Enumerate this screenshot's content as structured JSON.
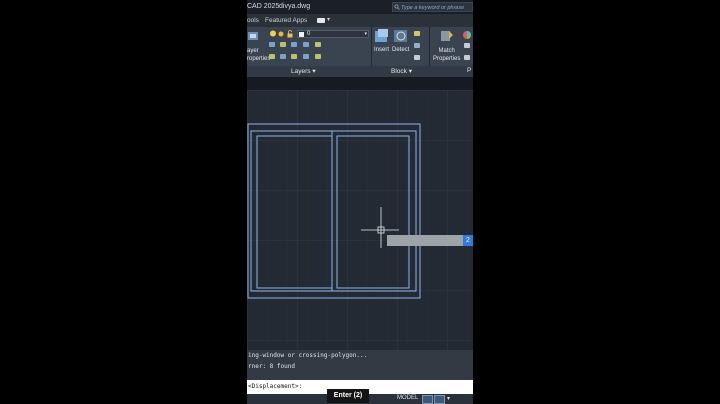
{
  "title_bar": {
    "app": "CAD 2025",
    "file": "divya.dwg",
    "search_placeholder": "Type a keyword or phrase"
  },
  "tabs": [
    "ools",
    "Featured Apps"
  ],
  "ribbon": {
    "layer_properties": "ayer\nroperties",
    "current_layer": "0",
    "insert_label": "Insert",
    "detect_label": "Detect",
    "match_props": "Match\nProperties",
    "panels": {
      "layers": "Layers ▾",
      "block": "Block ▾",
      "props_partial": "P"
    }
  },
  "command_history": [
    "ing-window or crossing-polygon...",
    "rner: 8 found"
  ],
  "command_line": "<Displacement>:",
  "dynamic_input": {
    "value_chip": "2"
  },
  "status_bar": {
    "model": "MODEL"
  },
  "tooltip": {
    "label": "Enter (2)"
  },
  "colors": {
    "accent": "#2c7be0",
    "rect": "#8fb3e8"
  }
}
